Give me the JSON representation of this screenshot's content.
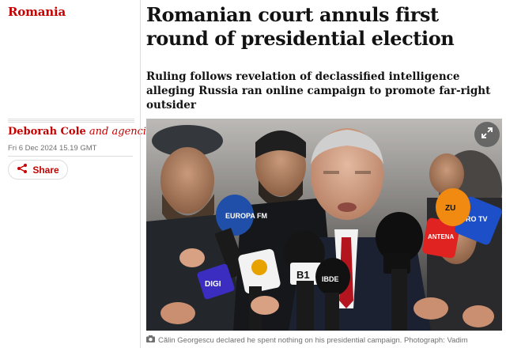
{
  "section": {
    "tag": "Romania"
  },
  "article": {
    "headline": "Romanian court annuls first round of presidential election",
    "standfirst": "Ruling follows revelation of declassified intelligence alleging Russia ran online campaign to promote far-right outsider",
    "byline_author": "Deborah Cole",
    "byline_suffix": " and agencies",
    "dateline": "Fri 6 Dec 2024 15.19 GMT",
    "share_label": "Share"
  },
  "image": {
    "caption": "Călin Georgescu declared he spent nothing on his presidential campaign. Photograph: Vadim",
    "mic_labels": [
      "EUROPA FM",
      "DIGI",
      "B1",
      "ANTENA",
      "PRO TV",
      "ZU",
      "IBDE"
    ]
  },
  "icons": {
    "share": "share-icon",
    "expand": "expand-icon",
    "camera": "camera-icon"
  },
  "colors": {
    "accent": "#c70000",
    "text": "#121212",
    "muted": "#707070"
  }
}
